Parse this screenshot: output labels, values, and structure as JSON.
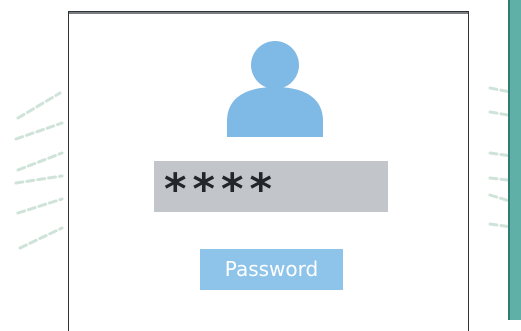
{
  "login_card": {
    "avatar_icon": "user-avatar-icon",
    "password_field": {
      "value": "****"
    },
    "submit_button": {
      "label": "Password"
    }
  },
  "colors": {
    "avatar": "#7fb9e6",
    "field_background": "#c2c6cb",
    "button_background": "#8ec3ea",
    "button_text": "#ffffff",
    "decorative_dashes": "#cfe3d9",
    "edge_stripe": "#5fb0a6",
    "card_border": "#2f3338"
  }
}
